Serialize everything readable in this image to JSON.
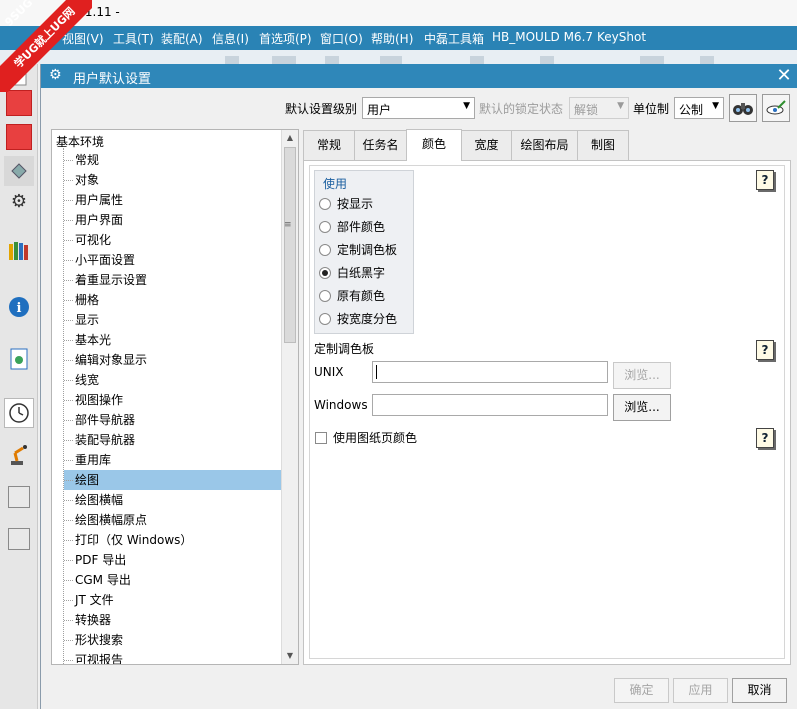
{
  "app": {
    "title": "1.0.1.11 -",
    "menu": [
      "视图(V)",
      "工具(T)",
      "装配(A)",
      "信息(I)",
      "首选项(P)",
      "窗口(O)",
      "帮助(H)",
      "中磊工具箱",
      "HB_MOULD M6.7",
      "KeyShot"
    ]
  },
  "watermark": {
    "line1": "9SUG",
    "line2": "学UG就上UG网"
  },
  "left_rail": {
    "icons": [
      "red-square-icon",
      "red-square-icon",
      "diamond-icon",
      "gear-icon",
      "books-icon",
      "info-icon",
      "document-icon",
      "clock-icon",
      "robot-arm-icon",
      "empty-square-icon",
      "empty-square-icon"
    ]
  },
  "dialog": {
    "title": "用户默认设置",
    "close": "✕",
    "settings_level_label": "默认设置级别",
    "settings_level_value": "用户",
    "lock_state_label": "默认的锁定状态",
    "lock_state_value": "解锁",
    "unit_label": "单位制",
    "unit_value": "公制",
    "tree": {
      "root": "基本环境",
      "items": [
        "常规",
        "对象",
        "用户属性",
        "用户界面",
        "可视化",
        "小平面设置",
        "着重显示设置",
        "栅格",
        "显示",
        "基本光",
        "编辑对象显示",
        "线宽",
        "视图操作",
        "部件导航器",
        "装配导航器",
        "重用库",
        "绘图",
        "绘图横幅",
        "绘图横幅原点",
        "打印（仅 Windows）",
        "PDF 导出",
        "CGM 导出",
        "JT 文件",
        "转换器",
        "形状搜索",
        "可视报告"
      ],
      "selected_index": 16
    },
    "tabs": [
      "常规",
      "任务名",
      "颜色",
      "宽度",
      "绘图布局",
      "制图"
    ],
    "active_tab": 2,
    "use_group": {
      "title": "使用",
      "options": [
        "按显示",
        "部件颜色",
        "定制调色板",
        "白纸黑字",
        "原有颜色",
        "按宽度分色"
      ],
      "selected_index": 3
    },
    "palette_section": "定制调色板",
    "unix_label": "UNIX",
    "unix_value": "",
    "unix_browse": "浏览...",
    "windows_label": "Windows",
    "windows_value": "",
    "windows_browse": "浏览...",
    "use_drawing_colors": "使用图纸页颜色",
    "help": "?",
    "buttons": {
      "ok": "确定",
      "apply": "应用",
      "cancel": "取消"
    }
  }
}
